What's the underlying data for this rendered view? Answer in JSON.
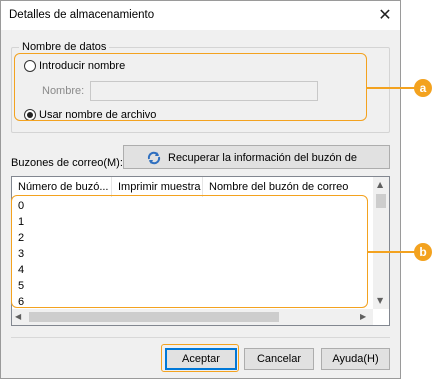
{
  "window": {
    "title": "Detalles de almacenamiento",
    "close_glyph": "✕"
  },
  "data_name_group": {
    "legend": "Nombre de datos",
    "radio_enter_name": "Introducir nombre",
    "name_label": "Nombre:",
    "name_value": "",
    "radio_use_filename": "Usar nombre de archivo",
    "selected": "use_filename"
  },
  "mailboxes": {
    "label": "Buzones de correo(M):",
    "retrieve_button": "Recuperar la información del buzón de correo",
    "columns": [
      "Número de buzó...",
      "Imprimir muestra",
      "Nombre del buzón de correo"
    ],
    "rows": [
      "0",
      "1",
      "2",
      "3",
      "4",
      "5",
      "6"
    ]
  },
  "buttons": {
    "ok": "Aceptar",
    "cancel": "Cancelar",
    "help": "Ayuda(H)"
  },
  "callouts": {
    "a": "a",
    "b": "b"
  },
  "colors": {
    "callout": "#f3a21f",
    "dialog_bg": "#f0f0f0",
    "default_button_border": "#0078d7"
  },
  "icons": {
    "retrieve": "refresh-icon"
  }
}
